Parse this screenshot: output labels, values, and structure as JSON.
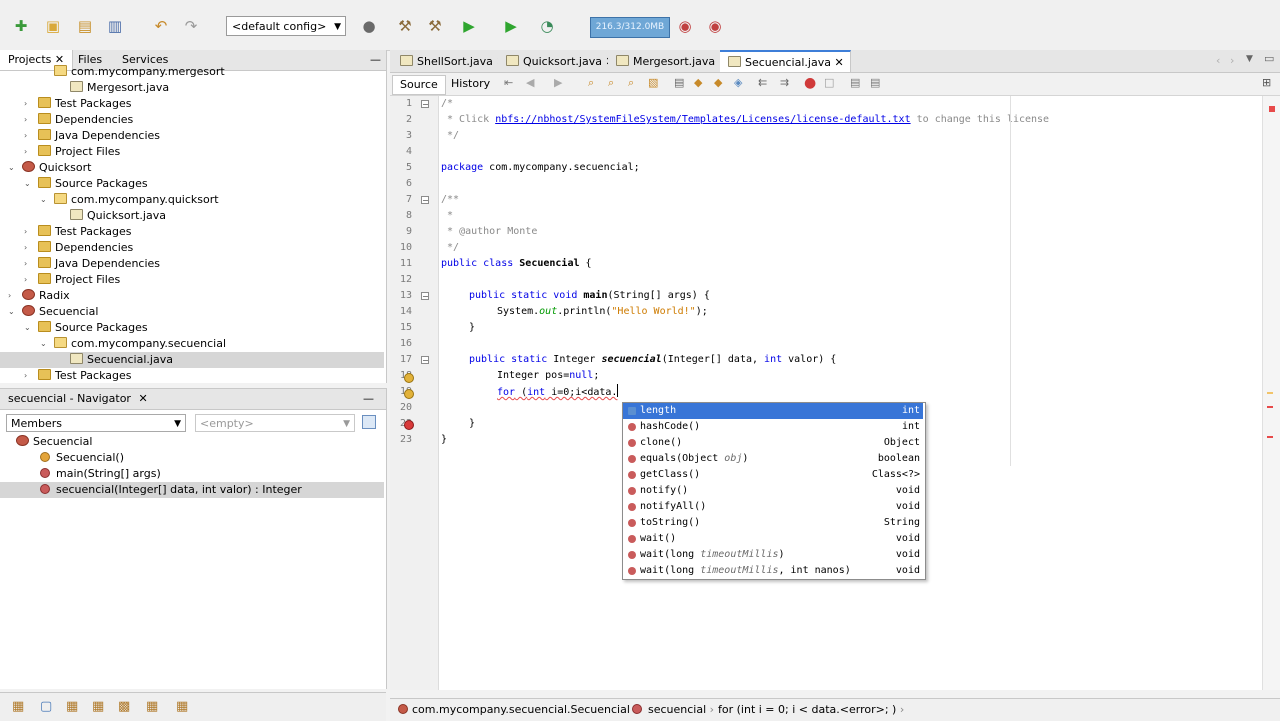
{
  "toolbar": {
    "config_label": "<default config>",
    "memory_label": "216.3/312.0MB"
  },
  "projects_panel": {
    "tabs": [
      "Projects",
      "Files",
      "Services"
    ],
    "tree": [
      {
        "label": "com.mycompany.mergesort",
        "icon": "package-icon",
        "expand": ""
      },
      {
        "label": "Mergesort.java",
        "icon": "java-file-icon",
        "expand": ""
      },
      {
        "label": "Test Packages",
        "icon": "package-folder-icon",
        "expand": "›"
      },
      {
        "label": "Dependencies",
        "icon": "package-folder-icon",
        "expand": "›"
      },
      {
        "label": "Java Dependencies",
        "icon": "package-folder-icon",
        "expand": "›"
      },
      {
        "label": "Project Files",
        "icon": "package-folder-icon",
        "expand": "›"
      },
      {
        "label": "Quicksort",
        "icon": "project-icon",
        "expand": "⌄"
      },
      {
        "label": "Source Packages",
        "icon": "package-folder-icon",
        "expand": "⌄"
      },
      {
        "label": "com.mycompany.quicksort",
        "icon": "package-icon",
        "expand": "⌄"
      },
      {
        "label": "Quicksort.java",
        "icon": "java-file-icon",
        "expand": ""
      },
      {
        "label": "Test Packages",
        "icon": "package-folder-icon",
        "expand": "›"
      },
      {
        "label": "Dependencies",
        "icon": "package-folder-icon",
        "expand": "›"
      },
      {
        "label": "Java Dependencies",
        "icon": "package-folder-icon",
        "expand": "›"
      },
      {
        "label": "Project Files",
        "icon": "package-folder-icon",
        "expand": "›"
      },
      {
        "label": "Radix",
        "icon": "project-icon",
        "expand": "›"
      },
      {
        "label": "Secuencial",
        "icon": "project-icon",
        "expand": "⌄"
      },
      {
        "label": "Source Packages",
        "icon": "package-folder-icon",
        "expand": "⌄"
      },
      {
        "label": "com.mycompany.secuencial",
        "icon": "package-icon",
        "expand": "⌄"
      },
      {
        "label": "Secuencial.java",
        "icon": "java-file-icon",
        "expand": ""
      },
      {
        "label": "Test Packages",
        "icon": "package-folder-icon",
        "expand": "›"
      }
    ]
  },
  "navigator": {
    "title": "secuencial - Navigator",
    "members_label": "Members",
    "empty_label": "<empty>",
    "items": [
      {
        "label": "Secuencial"
      },
      {
        "label": "Secuencial()"
      },
      {
        "label": "main(String[] args)"
      },
      {
        "label": "secuencial(Integer[] data, int valor) : Integer"
      }
    ]
  },
  "editor": {
    "tabs": [
      "ShellSort.java",
      "Quicksort.java",
      "Mergesort.java",
      "Secuencial.java"
    ],
    "source_tab": "Source",
    "history_tab": "History",
    "line_numbers": [
      "1",
      "2",
      "3",
      "4",
      "5",
      "6",
      "7",
      "8",
      "9",
      "10",
      "11",
      "12",
      "13",
      "14",
      "15",
      "16",
      "17",
      "18",
      "19",
      "20",
      "22",
      "23"
    ],
    "code": {
      "l1": "/*",
      "l2_a": " * Click ",
      "l2_link": "nbfs://nbhost/SystemFileSystem/Templates/Licenses/license-default.txt",
      "l2_b": " to change this license",
      "l3": " */",
      "l5_kw": "package",
      "l5_rest": " com.mycompany.secuencial;",
      "l7": "/**",
      "l8": " *",
      "l9_a": " * ",
      "l9_tag": "@author",
      "l9_b": " Monte",
      "l10": " */",
      "l11_kw": "public class ",
      "l11_name": "Secuencial",
      "l11_rest": " {",
      "l13_kw": "public static void ",
      "l13_name": "main",
      "l13_rest": "(String[] args) {",
      "l14_a": "System.",
      "l14_fld": "out",
      "l14_b": ".println(",
      "l14_str": "\"Hello World!\"",
      "l14_c": ");",
      "l15": "}",
      "l17_kw": "public static ",
      "l17_type": "Integer ",
      "l17_name": "secuencial",
      "l17_rest": "(Integer[] data, ",
      "l17_kw2": "int",
      "l17_rest2": " valor) {",
      "l18_a": "Integer pos=",
      "l18_kw": "null",
      "l18_b": ";",
      "l19_kw": "for",
      "l19_a": " (",
      "l19_kw2": "int",
      "l19_b": " i=0;i<data.",
      "l20": "}",
      "l22": "}"
    }
  },
  "completion": {
    "items": [
      {
        "name": "length",
        "param": "",
        "ret": "int",
        "kind": "field"
      },
      {
        "name": "hashCode()",
        "param": "",
        "ret": "int",
        "kind": "method"
      },
      {
        "name": "clone()",
        "param": "",
        "ret": "Object",
        "kind": "method"
      },
      {
        "name": "equals(Object ",
        "param": "obj",
        "tail": ")",
        "ret": "boolean",
        "kind": "method"
      },
      {
        "name": "getClass()",
        "param": "",
        "ret": "Class<?>",
        "kind": "method"
      },
      {
        "name": "notify()",
        "param": "",
        "ret": "void",
        "kind": "method"
      },
      {
        "name": "notifyAll()",
        "param": "",
        "ret": "void",
        "kind": "method"
      },
      {
        "name": "toString()",
        "param": "",
        "ret": "String",
        "kind": "method"
      },
      {
        "name": "wait()",
        "param": "",
        "ret": "void",
        "kind": "method"
      },
      {
        "name": "wait(long ",
        "param": "timeoutMillis",
        "tail": ")",
        "ret": "void",
        "kind": "method"
      },
      {
        "name": "wait(long ",
        "param": "timeoutMillis",
        "tail": ", int nanos)",
        "ret": "void",
        "kind": "method"
      }
    ]
  },
  "statusbar": {
    "crumb1": "com.mycompany.secuencial.Secuencial",
    "crumb2": "secuencial",
    "crumb3": "for (int i = 0; i < data.<error>; )"
  },
  "colors": {
    "selection": "#3875d7",
    "keyword": "#0000e6",
    "string": "#ce7b00",
    "comment": "#8a8a8a"
  }
}
